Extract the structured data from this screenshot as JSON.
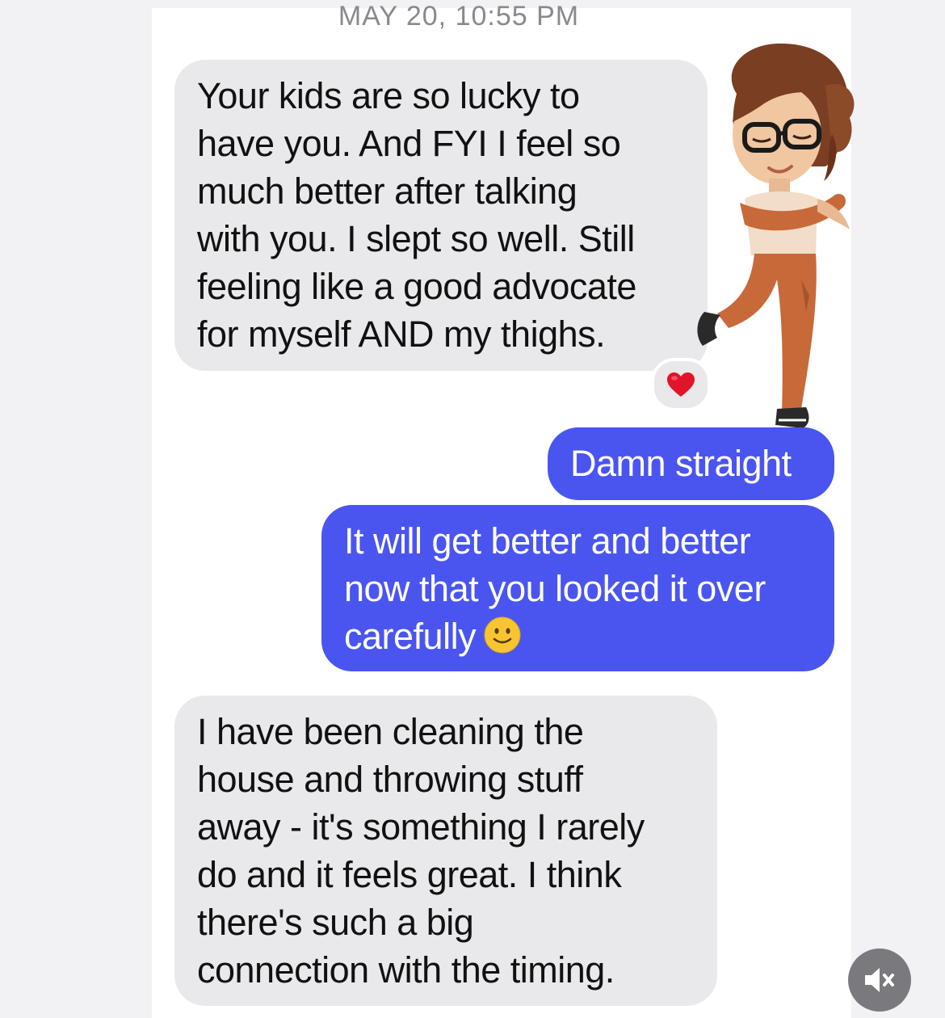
{
  "conversation": {
    "timestamp": "MAY 20, 10:55 PM",
    "messages": [
      {
        "direction": "received",
        "lines": [
          "Your kids are so lucky to",
          "have you. And FYI I feel so",
          "much better after talking",
          "with you.  I slept so well. Still",
          "feeling like a good advocate",
          "for myself AND my thighs."
        ],
        "reaction": "heart"
      },
      {
        "direction": "sent",
        "lines": [
          "Damn straight"
        ]
      },
      {
        "direction": "sent",
        "lines": [
          "It will get better and better",
          "now that you looked it over",
          "carefully"
        ],
        "trailing_emoji": "slightly-smiling-face"
      },
      {
        "direction": "received",
        "lines": [
          "I have been cleaning the",
          "house and throwing stuff",
          "away - it's something I rarely",
          "do and it feels great. I think",
          "there's such a big",
          "connection with the timing."
        ]
      }
    ],
    "sticker": "memoji-hugging-woman-sticker"
  },
  "controls": {
    "mute_icon": "speaker-muted-icon"
  },
  "colors": {
    "sent_bubble": "#4a55f0",
    "received_bubble": "#e9e9eb",
    "heart": "#e0142a"
  }
}
